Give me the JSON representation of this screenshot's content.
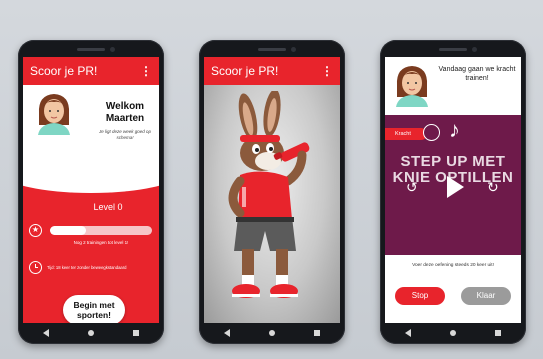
{
  "app": {
    "title": "Scoor je PR!",
    "accent_color": "#e8242c",
    "purple_color": "#6e1a4a"
  },
  "home_screen": {
    "welcome_title": "Welkom Maarten",
    "welcome_subtitle": "Je ligt deze week goed op schema!",
    "level_label": "Level 0",
    "progress_fraction": 0.35,
    "progress_note": "Nog 2 trainingen tot level 1!",
    "time_note": "Tijd: 18 keer ter zonder beweegkstandaard",
    "begin_button": "Begin met sporten!",
    "icons": [
      "menu-icon",
      "star-icon",
      "clock-icon",
      "avatar"
    ]
  },
  "mascot_screen": {
    "title": "Scoor je PR!",
    "mascot": "rabbit-mascot-drinking"
  },
  "exercise_screen": {
    "speech": "Vandaag gaan we kracht trainen!",
    "category_tag": "Kracht",
    "exercise_title": "STEP UP MET KNIE OPTILLEN",
    "note": "Voer deze oefening steeds 20 keer uit!",
    "stop_button": "Stop",
    "done_button": "Klaar",
    "icons": [
      "music-note-icon",
      "rewind-icon",
      "play-icon",
      "forward-icon",
      "kracht-figure-icon"
    ]
  }
}
